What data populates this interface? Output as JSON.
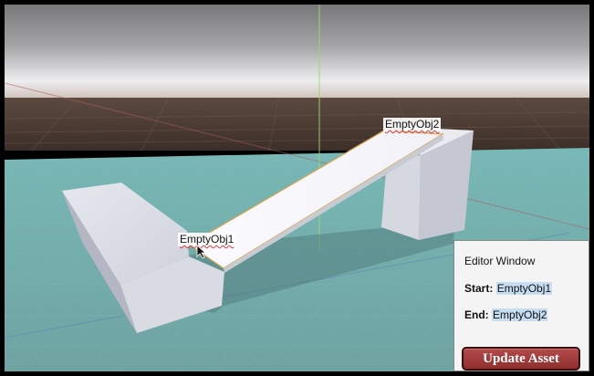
{
  "scene": {
    "objects": [
      {
        "name": "EmptyObj1"
      },
      {
        "name": "EmptyObj2"
      }
    ],
    "colors": {
      "sky_top": "#6f6f72",
      "horizon": "#e8e8ea",
      "ground_far": "#3f302a",
      "floor": "#7fb8b7",
      "cube": "#d7d9e0",
      "ramp": "#f7f7fb"
    }
  },
  "labels": {
    "obj1": "EmptyObj1",
    "obj2": "EmptyObj2"
  },
  "editor": {
    "title": "Editor Window",
    "start_label": "Start:",
    "start_value": "EmptyObj1",
    "end_label": "End:",
    "end_value": "EmptyObj2",
    "button_label": "Update Asset",
    "button_color": "#9e3a3a"
  }
}
